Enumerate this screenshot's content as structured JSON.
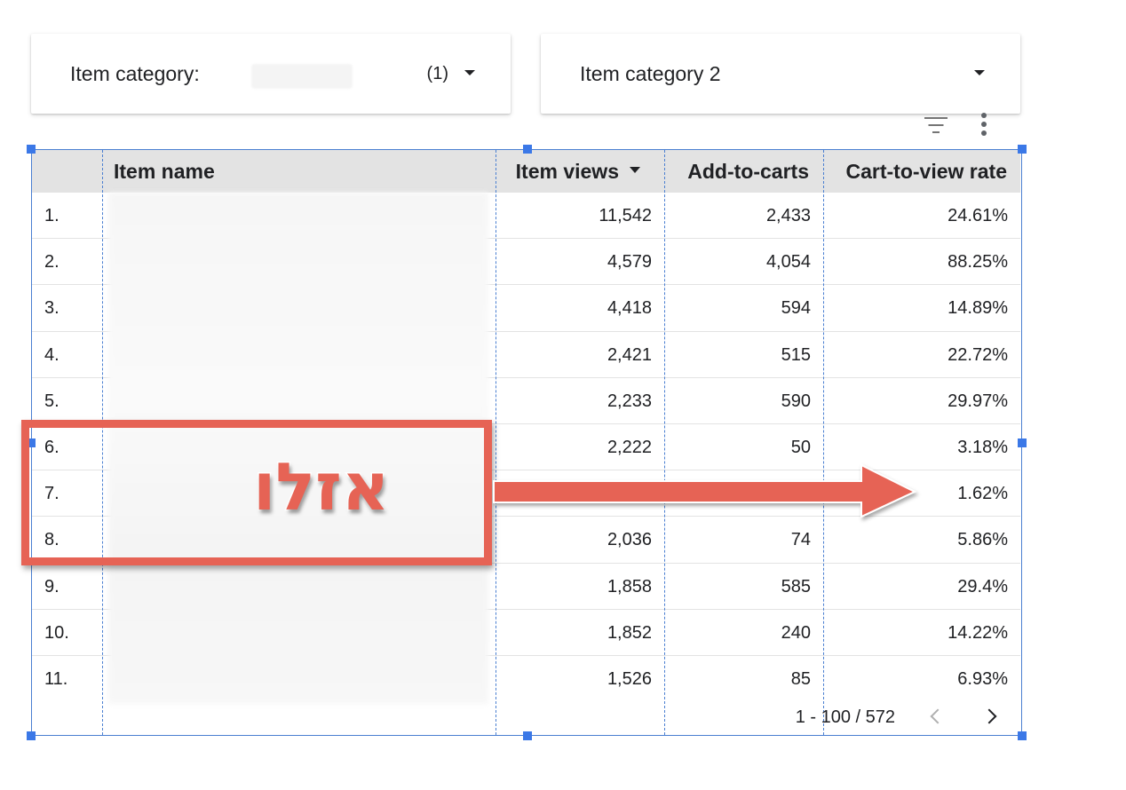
{
  "filters": [
    {
      "label": "Item category: ",
      "count": "(1)"
    },
    {
      "label": "Item category 2"
    }
  ],
  "table": {
    "headers": {
      "item_name": "Item name",
      "item_views": "Item views",
      "add_to_carts": "Add-to-carts",
      "cart_to_view_rate": "Cart-to-view rate"
    },
    "rows": [
      {
        "idx": "1.",
        "views": "11,542",
        "carts": "2,433",
        "rate": "24.61%"
      },
      {
        "idx": "2.",
        "views": "4,579",
        "carts": "4,054",
        "rate": "88.25%"
      },
      {
        "idx": "3.",
        "views": "4,418",
        "carts": "594",
        "rate": "14.89%"
      },
      {
        "idx": "4.",
        "views": "2,421",
        "carts": "515",
        "rate": "22.72%"
      },
      {
        "idx": "5.",
        "views": "2,233",
        "carts": "590",
        "rate": "29.97%"
      },
      {
        "idx": "6.",
        "views": "2,222",
        "carts": "50",
        "rate": "3.18%"
      },
      {
        "idx": "7.",
        "views": "",
        "carts": "",
        "rate": "1.62%"
      },
      {
        "idx": "8.",
        "views": "2,036",
        "carts": "74",
        "rate": "5.86%"
      },
      {
        "idx": "9.",
        "views": "1,858",
        "carts": "585",
        "rate": "29.4%"
      },
      {
        "idx": "10.",
        "views": "1,852",
        "carts": "240",
        "rate": "14.22%"
      },
      {
        "idx": "11.",
        "views": "1,526",
        "carts": "85",
        "rate": "6.93%"
      }
    ],
    "pagination": "1 - 100 / 572"
  },
  "annotation": {
    "text": "אזלו",
    "color": "#e66355"
  },
  "colors": {
    "selection": "#3b78e7",
    "header_bg": "#e3e3e3"
  }
}
